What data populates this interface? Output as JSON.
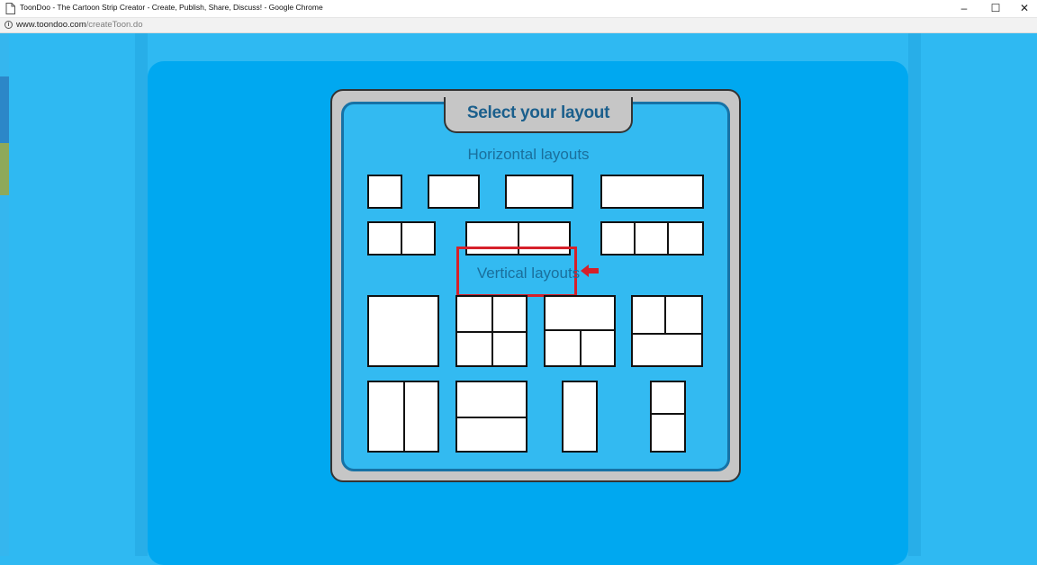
{
  "window": {
    "title": "ToonDoo - The Cartoon Strip Creator - Create, Publish, Share, Discuss! - Google Chrome",
    "minimize_glyph": "–",
    "maximize_glyph": "☐",
    "close_glyph": "✕"
  },
  "address": {
    "info_glyph": "i",
    "host": "www.toondoo.com",
    "path": "/createToon.do"
  },
  "dialog": {
    "title": "Select your layout",
    "horizontal_label": "Horizontal layouts",
    "vertical_label": "Vertical layouts"
  },
  "colors": {
    "page_bg": "#2fb9f2",
    "card_bg": "#00a8f0",
    "dialog_frame": "#c6c6c6",
    "dialog_inner": "#33baf1",
    "title_text": "#1b5f8c",
    "highlight": "#d6202a"
  },
  "icons": {
    "page": "document-icon",
    "info": "info-icon",
    "pointer": "arrow-left-icon"
  }
}
